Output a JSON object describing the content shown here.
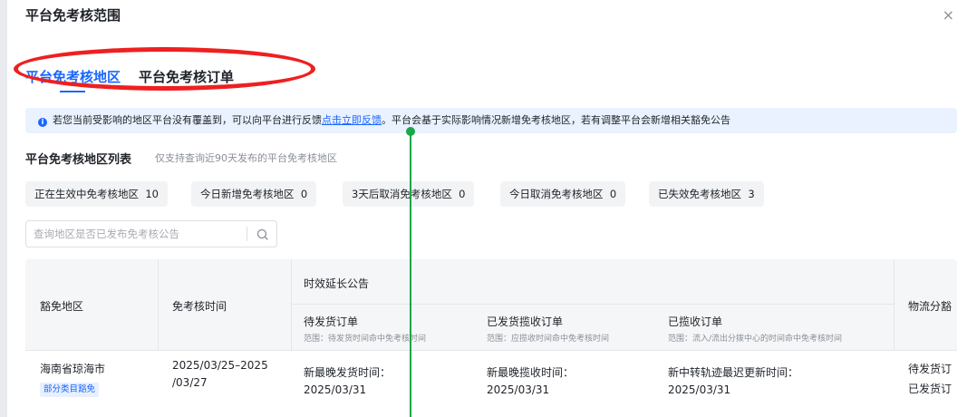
{
  "dialog": {
    "title": "平台免考核范围",
    "close_glyph": "×"
  },
  "tabs": [
    {
      "label": "平台免考核地区",
      "active": true
    },
    {
      "label": "平台免考核订单",
      "active": false
    }
  ],
  "notice": {
    "text_before": "若您当前受影响的地区平台没有覆盖到，可以向平台进行反馈",
    "link_text": "点击立即反馈",
    "text_after": "。平台会基于实际影响情况新增免考核地区，若有调整平台会新增相关豁免公告"
  },
  "section": {
    "title": "平台免考核地区列表",
    "subtitle": "仅支持查询近90天发布的平台免考核地区"
  },
  "stats": [
    {
      "label": "正在生效中免考核地区",
      "count": "10"
    },
    {
      "label": "今日新增免考核地区",
      "count": "0"
    },
    {
      "label": "3天后取消免考核地区",
      "count": "0"
    },
    {
      "label": "今日取消免考核地区",
      "count": "0"
    },
    {
      "label": "已失效免考核地区",
      "count": "3"
    }
  ],
  "search": {
    "placeholder": "查询地区是否已发布免考核公告",
    "value": ""
  },
  "table": {
    "headers": {
      "region": "豁免地区",
      "time": "免考核时间",
      "group": "时效延长公告",
      "col_pending_ship": "待发货订单",
      "col_pending_ship_sub": "范围：待发货时间命中免考核时间",
      "col_shipped": "已发货揽收订单",
      "col_shipped_sub": "范围：应揽收时间命中免考核时间",
      "col_collected": "已揽收订单",
      "col_collected_sub": "范围：流入/流出分拨中心的时间命中免考核时间",
      "logistics": "物流分豁"
    },
    "rows": [
      {
        "region": "海南省琼海市",
        "tag": "部分类目豁免",
        "time_line1": "2025/03/25–2025",
        "time_line2": "/03/27",
        "pending_label": "新最晚发货时间：",
        "pending_date": "2025/03/31",
        "shipped_label": "新最晚揽收时间：",
        "shipped_date": "2025/03/31",
        "collected_label": "新中转轨迹最迟更新时间：",
        "collected_date": "2025/03/31",
        "logistics_line1": "待发货订",
        "logistics_line2": "已发货订"
      }
    ]
  },
  "colors": {
    "accent": "#1966ff",
    "annotation_red": "#ee2020",
    "annotation_green": "#1aa64a"
  }
}
